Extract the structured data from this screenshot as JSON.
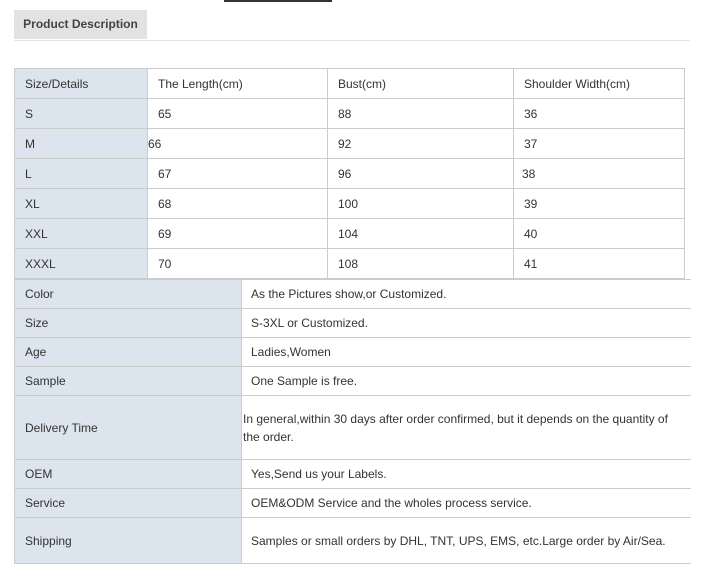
{
  "tab": {
    "label": "Product Description"
  },
  "size_table": {
    "headers": [
      "Size/Details",
      "The Length(cm)",
      "Bust(cm)",
      "Shoulder Width(cm)"
    ],
    "rows": [
      [
        "S",
        "65",
        "88",
        "36"
      ],
      [
        "M",
        "66",
        "92",
        "37"
      ],
      [
        "L",
        "67",
        "96",
        "38"
      ],
      [
        "XL",
        "68",
        "100",
        "39"
      ],
      [
        "XXL",
        "69",
        "104",
        "40"
      ],
      [
        "XXXL",
        "70",
        "108",
        "41"
      ]
    ]
  },
  "info_table": {
    "rows": [
      {
        "key": "Color",
        "value": "As the Pictures show,or Customized."
      },
      {
        "key": "Size",
        "value": "S-3XL or Customized."
      },
      {
        "key": "Age",
        "value": "Ladies,Women"
      },
      {
        "key": "Sample",
        "value": "One Sample is free."
      },
      {
        "key": "Delivery Time",
        "value": "In general,within 30 days after order confirmed, but it depends on the quantity of the order."
      },
      {
        "key": "OEM",
        "value": "Yes,Send us your Labels."
      },
      {
        "key": "Service",
        "value": "OEM&ODM Service and the wholes process service."
      },
      {
        "key": "Shipping",
        "value": "Samples or small orders by DHL, TNT, UPS, EMS, etc.Large order by Air/Sea."
      }
    ]
  },
  "colors": {
    "label_bg": "#dce4ee",
    "tab_bg": "#e2e2e2",
    "border": "#cccccc"
  }
}
